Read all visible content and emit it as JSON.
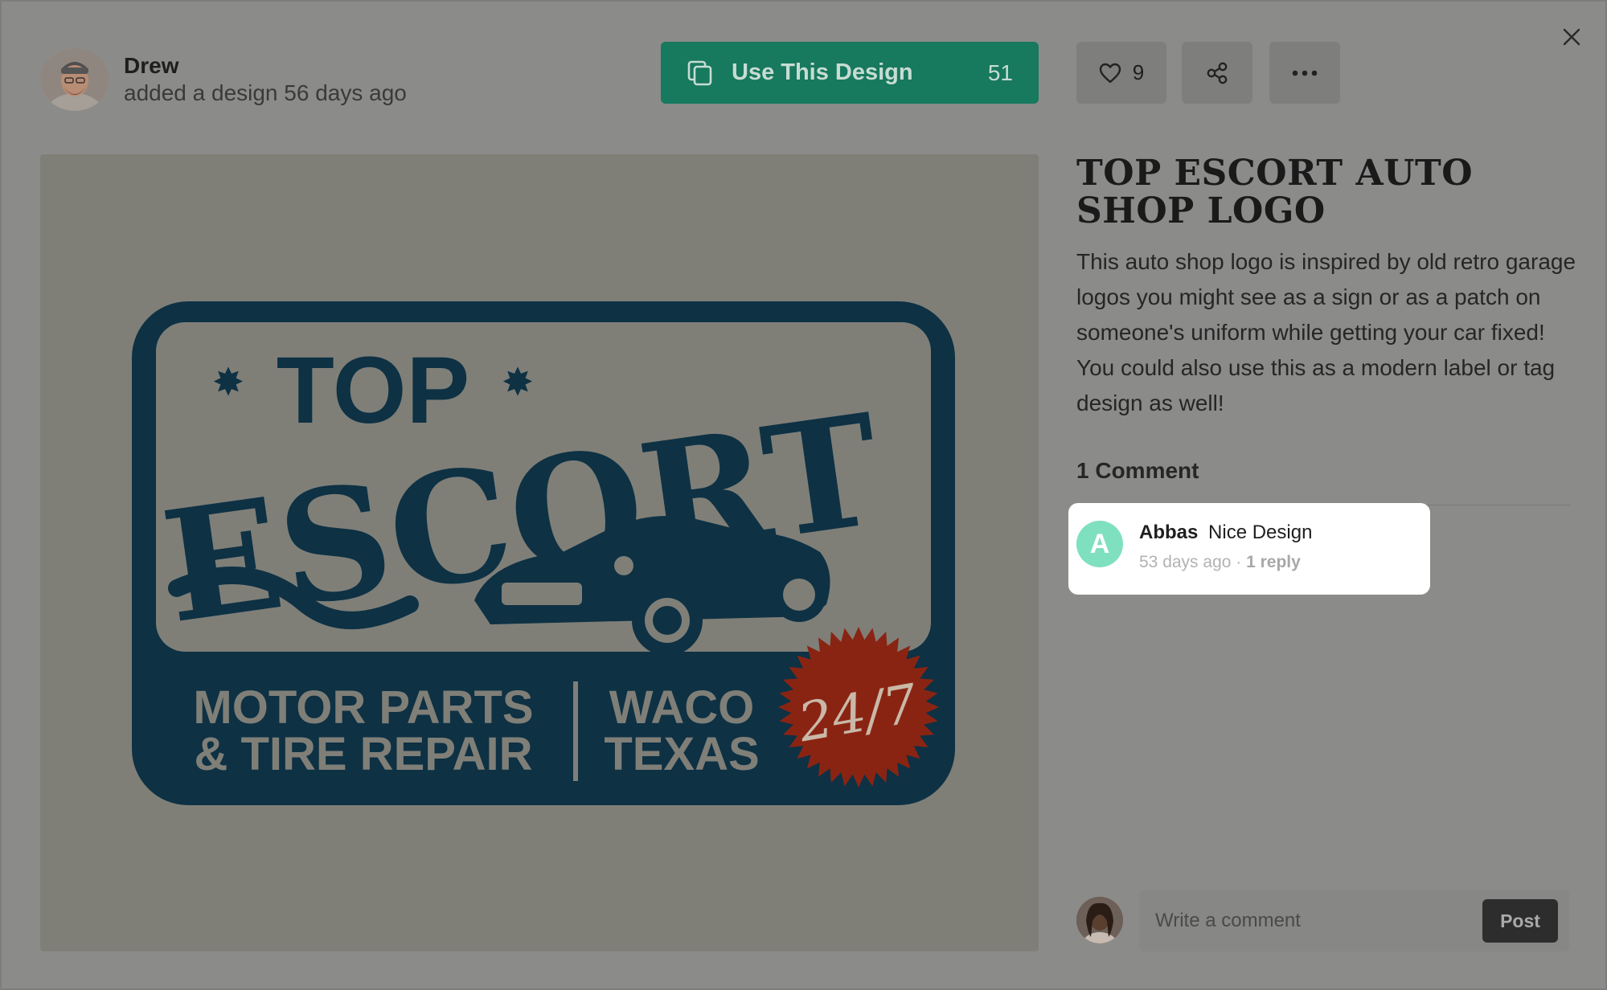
{
  "author": {
    "name": "Drew",
    "subtitle": "added a design 56 days ago"
  },
  "actions": {
    "use_label": "Use This Design",
    "use_count": "51",
    "like_count": "9"
  },
  "design": {
    "title": "TOP ESCORT AUTO SHOP LOGO",
    "description": "This auto shop logo is inspired by old retro garage logos you might see as a sign or as a patch on someone's uniform while getting your car fixed! You could also use this as a modern label or tag design as well!",
    "logo": {
      "line_top": "TOP",
      "line_main": "ESCORT",
      "left_bottom_1": "MOTOR PARTS",
      "left_bottom_2": "& TIRE REPAIR",
      "right_bottom_1": "WACO",
      "right_bottom_2": "TEXAS",
      "badge": "24/7"
    }
  },
  "comments": {
    "heading": "1 Comment",
    "items": [
      {
        "initial": "A",
        "name": "Abbas",
        "text": "Nice Design",
        "time": "53 days ago",
        "sep": " · ",
        "replies": "1 reply"
      }
    ]
  },
  "composer": {
    "placeholder": "Write a comment",
    "post_label": "Post"
  },
  "colors": {
    "primary_green": "#17795d",
    "logo_navy": "#0e3144",
    "logo_red": "#8a2412",
    "avatar_mint": "#7fe0c0"
  },
  "icons": {
    "close": "close-icon",
    "copy": "copy-icon",
    "heart": "heart-icon",
    "share": "share-icon",
    "more": "more-icon"
  }
}
